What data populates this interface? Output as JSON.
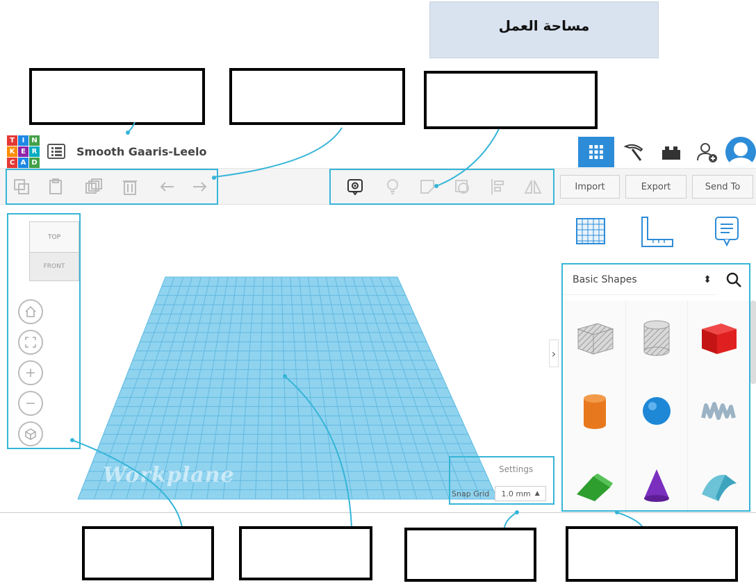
{
  "header_label": "مساحة العمل",
  "logo_letters": [
    "T",
    "I",
    "N",
    "K",
    "E",
    "R",
    "C",
    "A",
    "D"
  ],
  "logo_colors": [
    "#e53935",
    "#1e88e5",
    "#43a047",
    "#fb8c00",
    "#8e24aa",
    "#00acc1",
    "#e53935",
    "#1e88e5",
    "#43a047"
  ],
  "design_title": "Smooth Gaaris-Leelo",
  "right_buttons": {
    "import": "Import",
    "export": "Export",
    "send_to": "Send To"
  },
  "shapes_panel": {
    "category": "Basic Shapes"
  },
  "view_cube": {
    "top": "TOP",
    "front": "FRONT"
  },
  "workplane_label": "Workplane",
  "settings_label": "Settings",
  "snap_grid": {
    "label": "Snap Grid",
    "value": "1.0 mm"
  },
  "colors": {
    "accent": "#36b5d8",
    "grid_blue": "#8fd3ef",
    "active_tab": "#2d8cd8"
  }
}
